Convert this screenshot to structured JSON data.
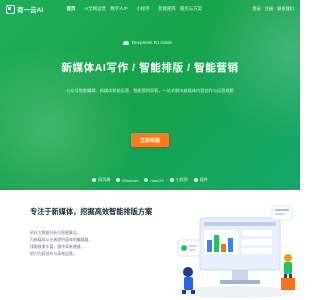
{
  "nav": {
    "brand": "有一云AI",
    "links": [
      "首页",
      "AI全网运营",
      "数字人IP",
      "小程序",
      "智能矩阵",
      "服务与方案"
    ],
    "actions": [
      "登录",
      "注册",
      "联系我们"
    ]
  },
  "hero": {
    "badge": "DeepSeek R1 inside",
    "headline": "新媒体AI写作 / 智能排版 / 智能营销",
    "subline": "公众号智能编辑、新媒体智能运营、智能营销获客，一站式解决新媒体内容创作与运营难题",
    "cta_label": "立即体验",
    "platforms": [
      "网页端",
      "Windows",
      "macOS",
      "小程序",
      "插件"
    ]
  },
  "feature": {
    "title": "专注于新媒体，挖掘高效智能排版方案",
    "desc_lines": [
      "依托大数据分析与智能算法，",
      "为新媒体从业者提供高效的编辑器，",
      "排版效果丰富，操作简单便捷，",
      "助力内容创作与高效运营。"
    ]
  },
  "colors": {
    "hero_green": "#1fae5b",
    "cta_orange": "#ff7a1a",
    "title_dark": "#1f2937"
  }
}
